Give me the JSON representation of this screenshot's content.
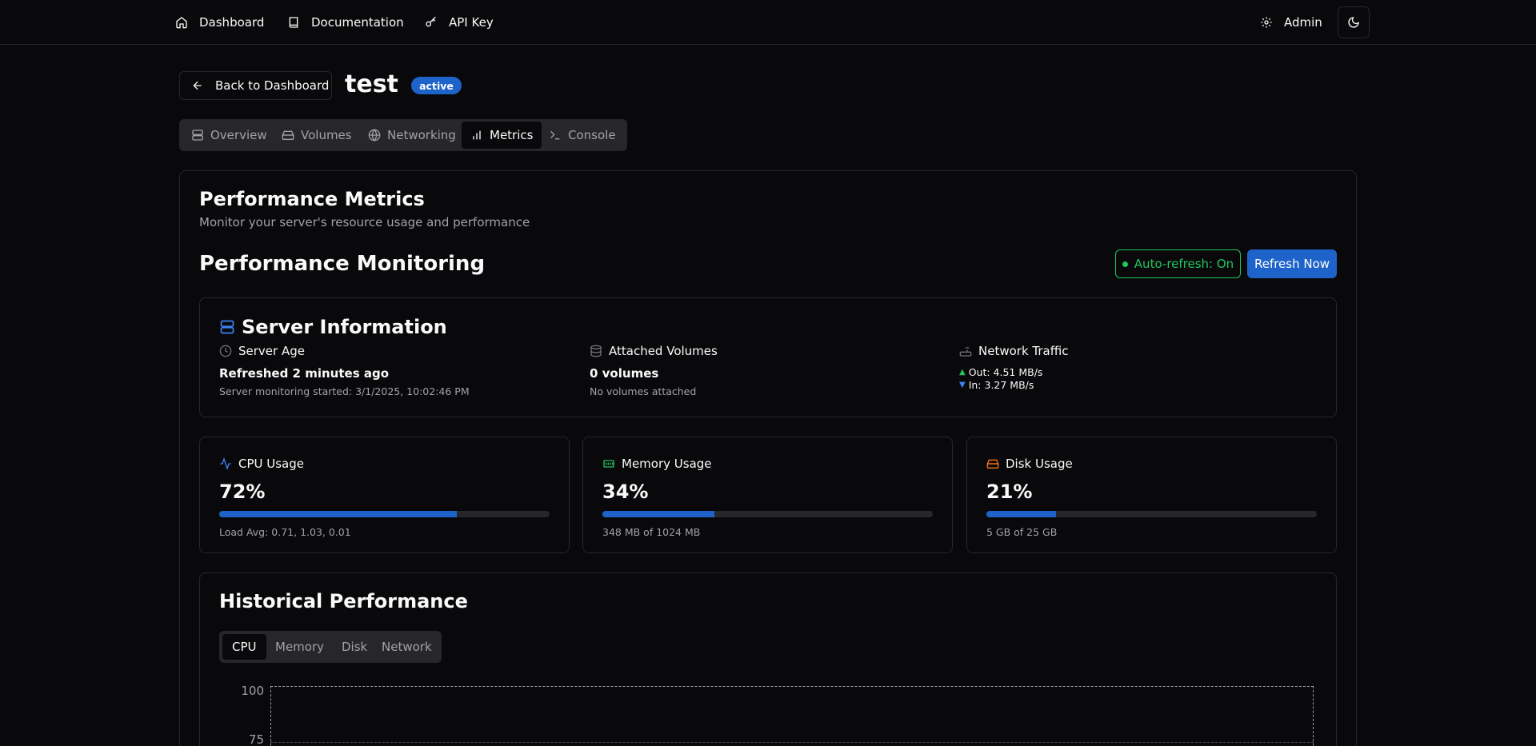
{
  "nav": {
    "dashboard": "Dashboard",
    "documentation": "Documentation",
    "api_key": "API Key",
    "admin": "Admin"
  },
  "header": {
    "back_label": "Back to Dashboard",
    "server_name": "test",
    "status": "active"
  },
  "tabs": [
    "Overview",
    "Volumes",
    "Networking",
    "Metrics",
    "Console"
  ],
  "active_tab": "Metrics",
  "metrics": {
    "title": "Performance Metrics",
    "subtitle": "Monitor your server's resource usage and performance",
    "monitoring_title": "Performance Monitoring",
    "auto_refresh": "Auto-refresh: On",
    "refresh_now": "Refresh Now"
  },
  "server_info": {
    "title": "Server Information",
    "age_label": "Server Age",
    "age_value": "Refreshed 2 minutes ago",
    "age_sub": "Server monitoring started: 3/1/2025, 10:02:46 PM",
    "volumes_label": "Attached Volumes",
    "volumes_value": "0 volumes",
    "volumes_sub": "No volumes attached",
    "network_label": "Network Traffic",
    "out": "Out: 4.51 MB/s",
    "in": "In: 3.27 MB/s"
  },
  "cpu": {
    "label": "CPU Usage",
    "value": "72%",
    "fraction": 0.72,
    "sub": "Load Avg: 0.71, 1.03, 0.01"
  },
  "memory": {
    "label": "Memory Usage",
    "value": "34%",
    "fraction": 0.34,
    "sub": "348 MB of 1024 MB"
  },
  "disk": {
    "label": "Disk Usage",
    "value": "21%",
    "fraction": 0.21,
    "sub": "5 GB of 25 GB"
  },
  "history": {
    "title": "Historical Performance",
    "tabs": [
      "CPU",
      "Memory",
      "Disk",
      "Network"
    ],
    "active": "CPU",
    "y_ticks": [
      "100",
      "75"
    ]
  },
  "colors": {
    "accent": "#1d63c9",
    "success": "#22c55e",
    "cpu_icon": "#3b82f6",
    "memory_icon": "#22c55e",
    "disk_icon": "#f97316"
  }
}
